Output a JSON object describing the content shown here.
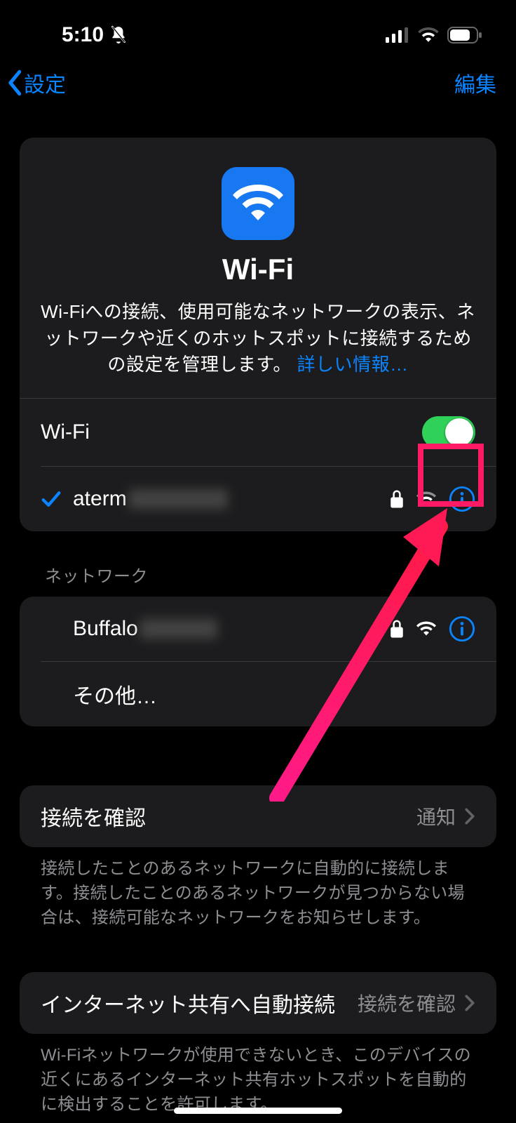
{
  "status": {
    "time": "5:10"
  },
  "nav": {
    "back": "設定",
    "edit": "編集"
  },
  "header": {
    "title": "Wi-Fi",
    "desc_prefix": "Wi-Fiへの接続、使用可能なネットワークの表示、ネットワークや近くのホットスポットに接続するための設定を管理します。",
    "link": "詳しい情報…"
  },
  "wifi_toggle": {
    "label": "Wi-Fi",
    "on": true
  },
  "connected": {
    "name": "aterm",
    "secured": true
  },
  "networks": {
    "label": "ネットワーク",
    "items": [
      {
        "name": "Buffalo",
        "secured": true
      }
    ],
    "other": "その他…"
  },
  "ask_join": {
    "label": "接続を確認",
    "value": "通知",
    "footer": "接続したことのあるネットワークに自動的に接続します。接続したことのあるネットワークが見つからない場合は、接続可能なネットワークをお知らせします。"
  },
  "hotspot": {
    "label": "インターネット共有へ自動接続",
    "value": "接続を確認",
    "footer": "Wi-Fiネットワークが使用できないとき、このデバイスの近くにあるインターネット共有ホットスポットを自動的に検出することを許可します。"
  }
}
